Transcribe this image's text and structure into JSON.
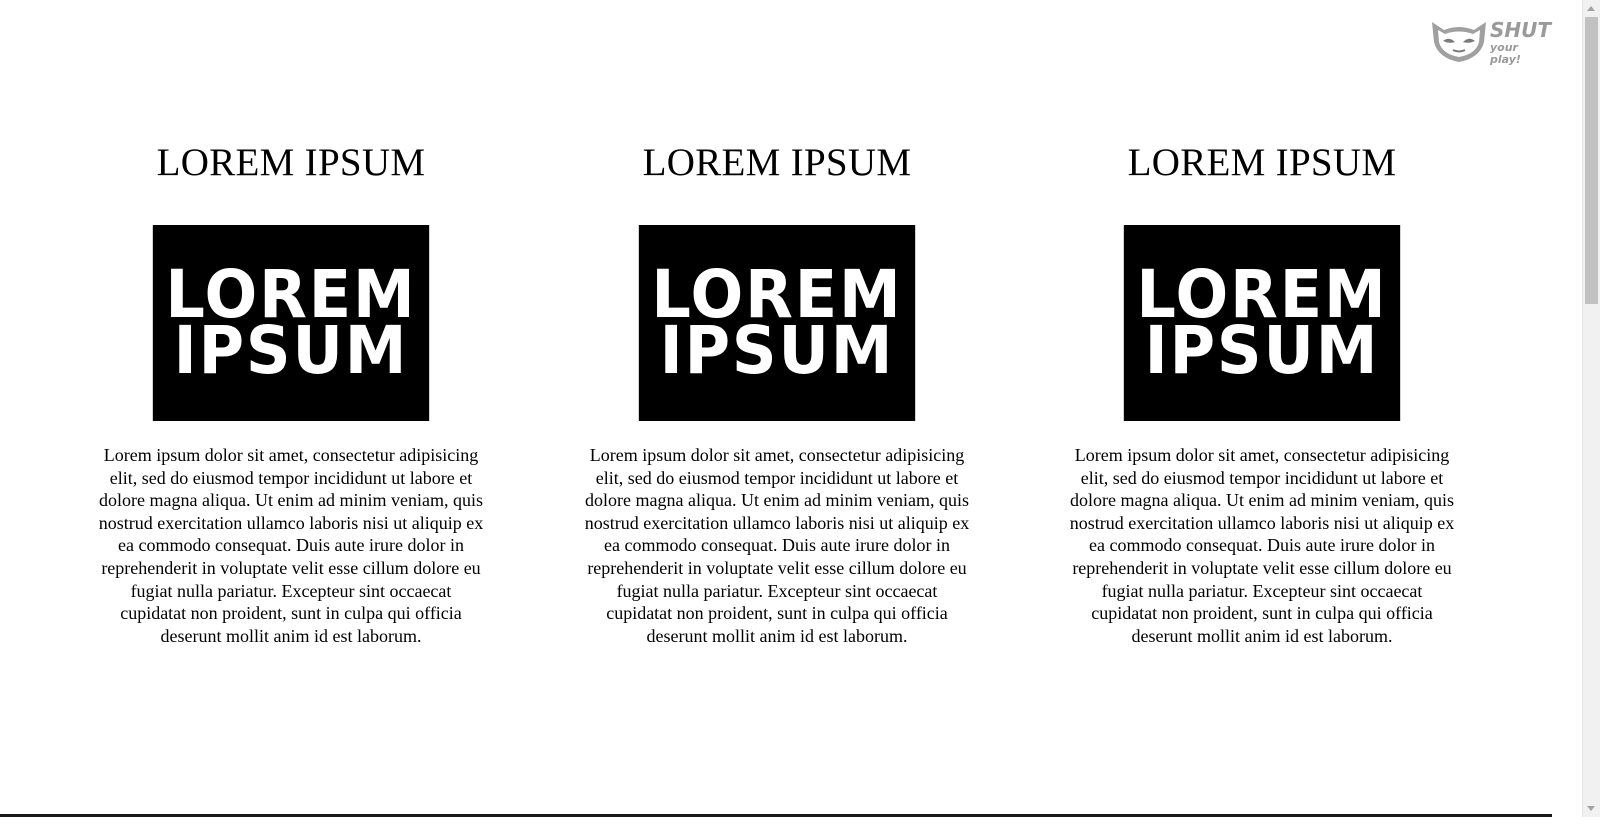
{
  "logo": {
    "name": "SHUT",
    "tagline": "your play!",
    "color": "#9a9a9a"
  },
  "columns": [
    {
      "title": "LOREM IPSUM",
      "image_line1": "LOREM",
      "image_line2": "IPSUM",
      "body": "Lorem ipsum dolor sit amet, consectetur adipisicing elit, sed do eiusmod tempor incididunt ut labore et dolore magna aliqua. Ut enim ad minim veniam, quis nostrud exercitation ullamco laboris nisi ut aliquip ex ea commodo consequat. Duis aute irure dolor in reprehenderit in voluptate velit esse cillum dolore eu fugiat nulla pariatur. Excepteur sint occaecat cupidatat non proident, sunt in culpa qui officia deserunt mollit anim id est laborum."
    },
    {
      "title": "LOREM IPSUM",
      "image_line1": "LOREM",
      "image_line2": "IPSUM",
      "body": "Lorem ipsum dolor sit amet, consectetur adipisicing elit, sed do eiusmod tempor incididunt ut labore et dolore magna aliqua. Ut enim ad minim veniam, quis nostrud exercitation ullamco laboris nisi ut aliquip ex ea commodo consequat. Duis aute irure dolor in reprehenderit in voluptate velit esse cillum dolore eu fugiat nulla pariatur. Excepteur sint occaecat cupidatat non proident, sunt in culpa qui officia deserunt mollit anim id est laborum."
    },
    {
      "title": "LOREM IPSUM",
      "image_line1": "LOREM",
      "image_line2": "IPSUM",
      "body": "Lorem ipsum dolor sit amet, consectetur adipisicing elit, sed do eiusmod tempor incididunt ut labore et dolore magna aliqua. Ut enim ad minim veniam, quis nostrud exercitation ullamco laboris nisi ut aliquip ex ea commodo consequat. Duis aute irure dolor in reprehenderit in voluptate velit esse cillum dolore eu fugiat nulla pariatur. Excepteur sint occaecat cupidatat non proident, sunt in culpa qui officia deserunt mollit anim id est laborum."
    }
  ],
  "colors": {
    "background": "#ffffff",
    "text": "#000000",
    "image_bg": "#000000",
    "image_text": "#ffffff"
  }
}
